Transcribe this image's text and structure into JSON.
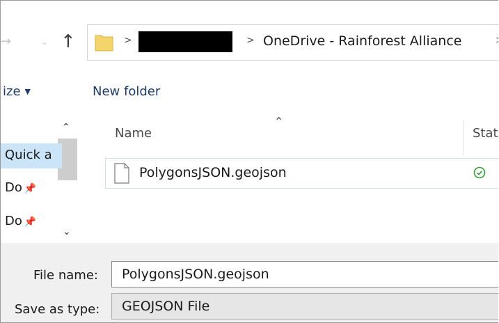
{
  "address": {
    "path": "OneDrive - Rainforest Alliance",
    "separator": ">"
  },
  "toolbar": {
    "organize_label": "ize",
    "new_folder_label": "New folder"
  },
  "navpane": {
    "items": [
      {
        "label": "Quick a"
      },
      {
        "label": "Do"
      },
      {
        "label": "Do"
      }
    ]
  },
  "filelist": {
    "columns": [
      "Name",
      "Stat"
    ],
    "files": [
      {
        "name": "PolygonsJSON.geojson",
        "status": "synced"
      }
    ]
  },
  "form": {
    "file_name_label": "File name:",
    "file_name_value": "PolygonsJSON.geojson",
    "save_type_label": "Save as type:",
    "save_type_value": "GEOJSON File"
  },
  "colors": {
    "selection": "#cce4f7",
    "link": "#1f3b66",
    "sync_ok": "#3a9a3a",
    "folder": "#f3d56b"
  }
}
